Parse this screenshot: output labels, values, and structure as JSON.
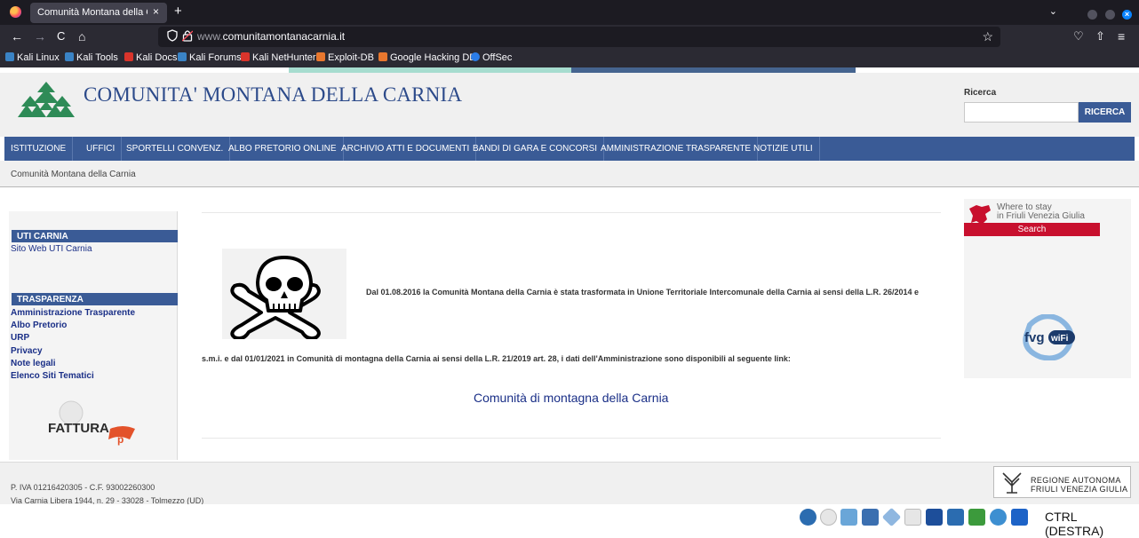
{
  "browser": {
    "tab_title": "Comunità Montana della Carnia",
    "tab_close": "×",
    "new_tab": "+",
    "tab_list": "⌄",
    "url_host": "www.",
    "url_domain": "comunitamontanacarnia.it",
    "back": "←",
    "forward": "→",
    "reload": "C",
    "home": "⌂",
    "pocket": "♡",
    "extensions": "⇧",
    "menu": "≡",
    "bookmarks": [
      "Kali Linux",
      "Kali Tools",
      "Kali Docs",
      "Kali Forums",
      "Kali NetHunter",
      "Exploit-DB",
      "Google Hacking DB",
      "OffSec"
    ]
  },
  "header": {
    "title": "COMUNITA' MONTANA DELLA CARNIA",
    "search_label": "Ricerca",
    "search_placeholder": "",
    "search_button": "RICERCA"
  },
  "menu": [
    "ISTITUZIONE",
    "UFFICI",
    "SPORTELLI CONVENZ.",
    "ALBO PRETORIO ONLINE",
    "ARCHIVIO ATTI E DOCUMENTI",
    "BANDI DI GARA E CONCORSI",
    "AMMINISTRAZIONE TRASPARENTE",
    "NOTIZIE UTILI"
  ],
  "breadcrumb": "Comunità Montana della Carnia",
  "sidebar": {
    "uti_title": "UTI CARNIA",
    "uti_link": "Sito Web UTI Carnia",
    "trasp_title": "TRASPARENZA",
    "trasp_links": [
      "Amministrazione Trasparente",
      "Albo Pretorio",
      "URP",
      "Privacy",
      "Note legali",
      "Elenco Siti Tematici"
    ],
    "fattura_logo": "FATTURA"
  },
  "main": {
    "notice_line1": "Dal 01.08.2016 la Comunità Montana della Carnia è stata trasformata in Unione Territoriale Intercomunale della Carnia ai sensi della L.R. 26/2014 e",
    "notice_line2": "s.m.i. e dal 01/01/2021 in Comunità di montagna della Carnia ai sensi della L.R. 21/2019 art. 28, i dati dell'Amministrazione sono disponibili al seguente link:",
    "link_text": "Comunità di montagna della Carnia"
  },
  "right_banner": {
    "where_line1": "Where to stay",
    "where_line2": "in Friuli Venezia Giulia",
    "search": "Search",
    "wifi_text": "fvg",
    "wifi_badge": "wiFi"
  },
  "footer": {
    "line1": "P. IVA 01216420305 - C.F. 93002260300",
    "line2": "Via Carnia Libera 1944, n. 29 - 33028 - Tolmezzo (UD)",
    "regione_line1": "REGIONE AUTONOMA",
    "regione_line2": "FRIULI VENEZIA GIULIA"
  },
  "taskbar": {
    "ctrl_label": "CTRL (DESTRA)"
  }
}
